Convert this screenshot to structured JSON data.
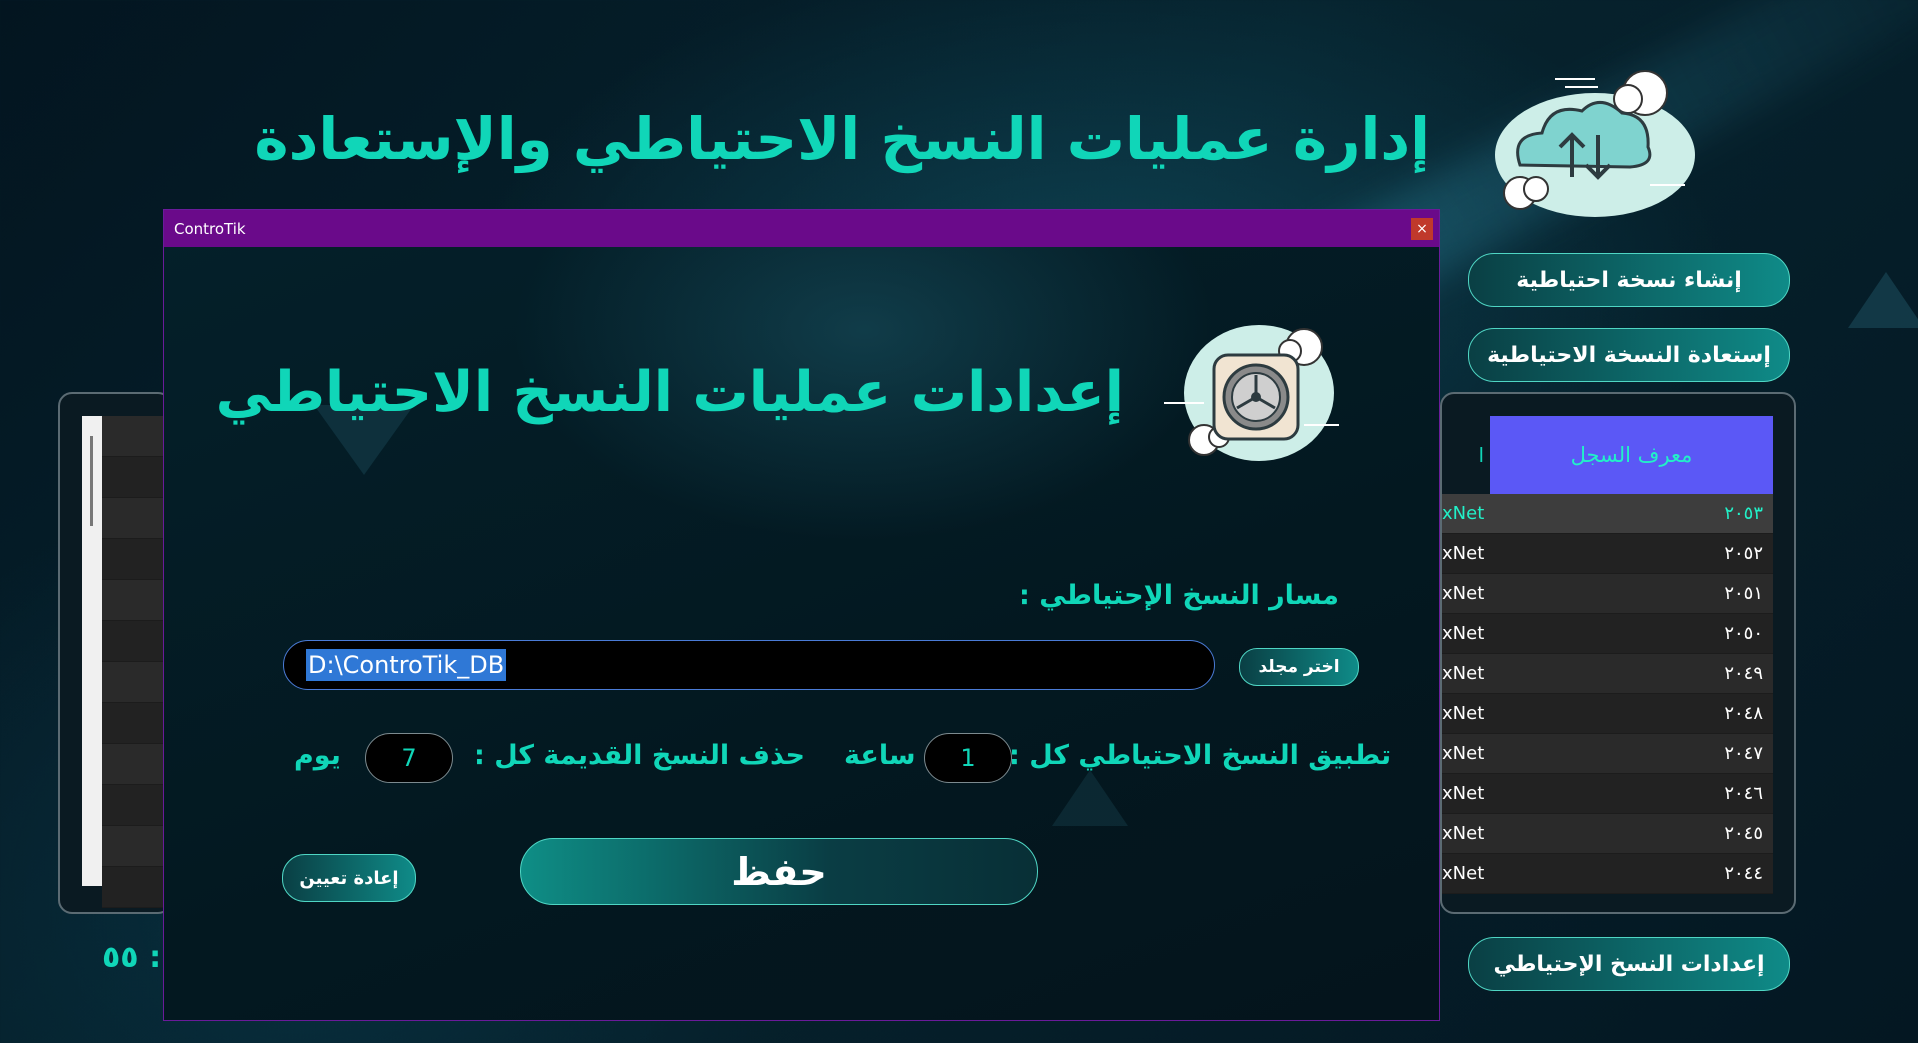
{
  "page": {
    "title": "إدارة عمليات النسخ الاحتياطي والإستعادة",
    "timer_text": "٥٥ :"
  },
  "sidebar": {
    "create_backup": "إنشاء نسخة احتياطية",
    "restore_backup": "إستعادة النسخة الاحتياطية",
    "backup_settings": "إعدادات النسخ الإحتياطي"
  },
  "log_table": {
    "header_id": "معرف السجل",
    "header_partial": "ا",
    "rows": [
      {
        "id": "٢٠٥٣",
        "name": "xNet"
      },
      {
        "id": "٢٠٥٢",
        "name": "xNet"
      },
      {
        "id": "٢٠٥١",
        "name": "xNet"
      },
      {
        "id": "٢٠٥٠",
        "name": "xNet"
      },
      {
        "id": "٢٠٤٩",
        "name": "xNet"
      },
      {
        "id": "٢٠٤٨",
        "name": "xNet"
      },
      {
        "id": "٢٠٤٧",
        "name": "xNet"
      },
      {
        "id": "٢٠٤٦",
        "name": "xNet"
      },
      {
        "id": "٢٠٤٥",
        "name": "xNet"
      },
      {
        "id": "٢٠٤٤",
        "name": "xNet"
      }
    ]
  },
  "dialog": {
    "app_name": "ControTik",
    "close_glyph": "×",
    "title": "إعدادات عمليات النسخ الاحتياطي",
    "path_label": "مسار النسخ الإحتياطي :",
    "path_value": "D:\\ControTik_DB",
    "choose_folder": "اختر مجلد",
    "backup_every_label": "تطبيق النسخ الاحتياطي كل :",
    "backup_every_value": "1",
    "backup_every_unit": "ساعة",
    "delete_old_label": "حذف النسخ القديمة كل :",
    "delete_old_value": "7",
    "delete_old_unit": "يوم",
    "save": "حفظ",
    "reset": "إعادة تعيين"
  },
  "colors": {
    "accent": "#10d6b8",
    "titlebar": "#6a0a8a",
    "table_header": "#5b58f6"
  }
}
